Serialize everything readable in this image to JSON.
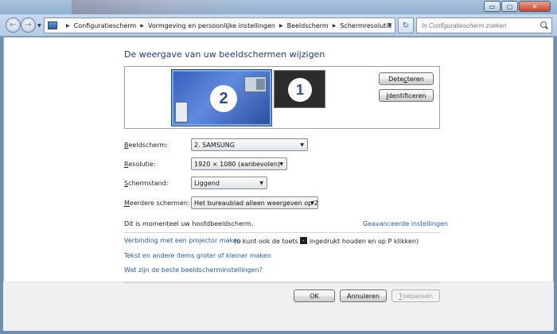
{
  "window": {
    "caption_min": "▭",
    "caption_max": "▢",
    "caption_close": "✕"
  },
  "nav": {
    "back": "←",
    "forward": "→",
    "breadcrumbs": [
      "Configuratiescherm",
      "Vormgeving en persoonlijke instellingen",
      "Beeldscherm",
      "Schermresolutie"
    ],
    "refresh": "↻",
    "search_placeholder": "In Configuratiescherm zoeken"
  },
  "page": {
    "heading": "De weergave van uw beeldschermen wijzigen",
    "monitors": [
      {
        "number": "2",
        "selected": true
      },
      {
        "number": "1",
        "selected": false
      }
    ],
    "detect_button": {
      "pre": "Dete",
      "accel": "c",
      "post": "teren"
    },
    "identify_button": {
      "pre": "",
      "accel": "I",
      "post": "dentificeren"
    },
    "fields": {
      "display": {
        "label_accel": "B",
        "label_rest": "eeldscherm:",
        "value": "2. SAMSUNG"
      },
      "resolution": {
        "label_accel": "R",
        "label_rest": "esolutie:",
        "value": "1920 × 1080 (aanbevolen)"
      },
      "orientation": {
        "label_accel": "S",
        "label_rest": "chermstand:",
        "value": "Liggend"
      },
      "multiple": {
        "label_accel": "M",
        "label_rest": "eerdere schermen:",
        "value": "Het bureaublad alleen weergeven op 2"
      }
    },
    "main_display_info": "Dit is momenteel uw hoofdbeeldscherm.",
    "advanced_link": "Geavanceerde instellingen",
    "projector_link": "Verbinding met een projector maken",
    "projector_hint_pre": "(u kunt ook de toets",
    "projector_hint_post": "ingedrukt houden en op P klikken)",
    "text_size_link": "Tekst en andere items groter of kleiner maken",
    "best_settings_link": "Wat zijn de beste beeldscherminstellingen?"
  },
  "footer": {
    "ok": "OK",
    "cancel": "Annuleren",
    "apply_accel": "T",
    "apply_rest": "oepassen"
  }
}
